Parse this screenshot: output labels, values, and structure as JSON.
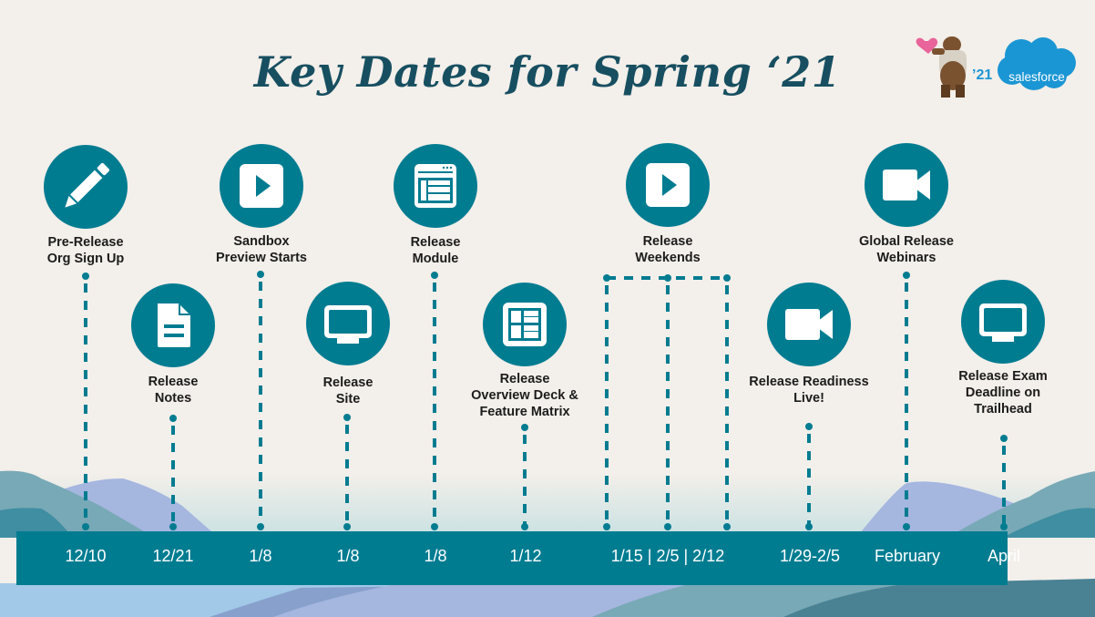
{
  "header": {
    "title": "Key Dates for Spring ‘21",
    "year_tag": "’21",
    "brand": "salesforce",
    "mascot": "bear-mascot-with-heart"
  },
  "colors": {
    "background": "#f3efea",
    "accent_teal": "#007c91",
    "title_color": "#174f61",
    "brand_blue": "#1b96d4",
    "heart_pink": "#e8649a"
  },
  "milestones": [
    {
      "label": "Pre-Release\nOrg Sign Up",
      "date": "12/10",
      "icon": "pencil-icon"
    },
    {
      "label": "Release\nNotes",
      "date": "12/21",
      "icon": "document-icon"
    },
    {
      "label": "Sandbox\nPreview Starts",
      "date": "1/8",
      "icon": "play-icon"
    },
    {
      "label": "Release\nSite",
      "date": "1/8",
      "icon": "monitor-icon"
    },
    {
      "label": "Release\nModule",
      "date": "1/8",
      "icon": "browser-window-icon"
    },
    {
      "label": "Release\nOverview Deck &\nFeature Matrix",
      "date": "1/12",
      "icon": "table-icon"
    },
    {
      "label": "Release\nWeekends",
      "date": "1/15 | 2/5 | 2/12",
      "icon": "play-icon"
    },
    {
      "label": "Release Readiness\nLive!",
      "date": "1/29-2/5",
      "icon": "video-camera-icon"
    },
    {
      "label": "Global Release\nWebinars",
      "date": "February",
      "icon": "video-camera-icon"
    },
    {
      "label": "Release Exam\nDeadline on\nTrailhead",
      "date": "April",
      "icon": "monitor-icon"
    }
  ]
}
